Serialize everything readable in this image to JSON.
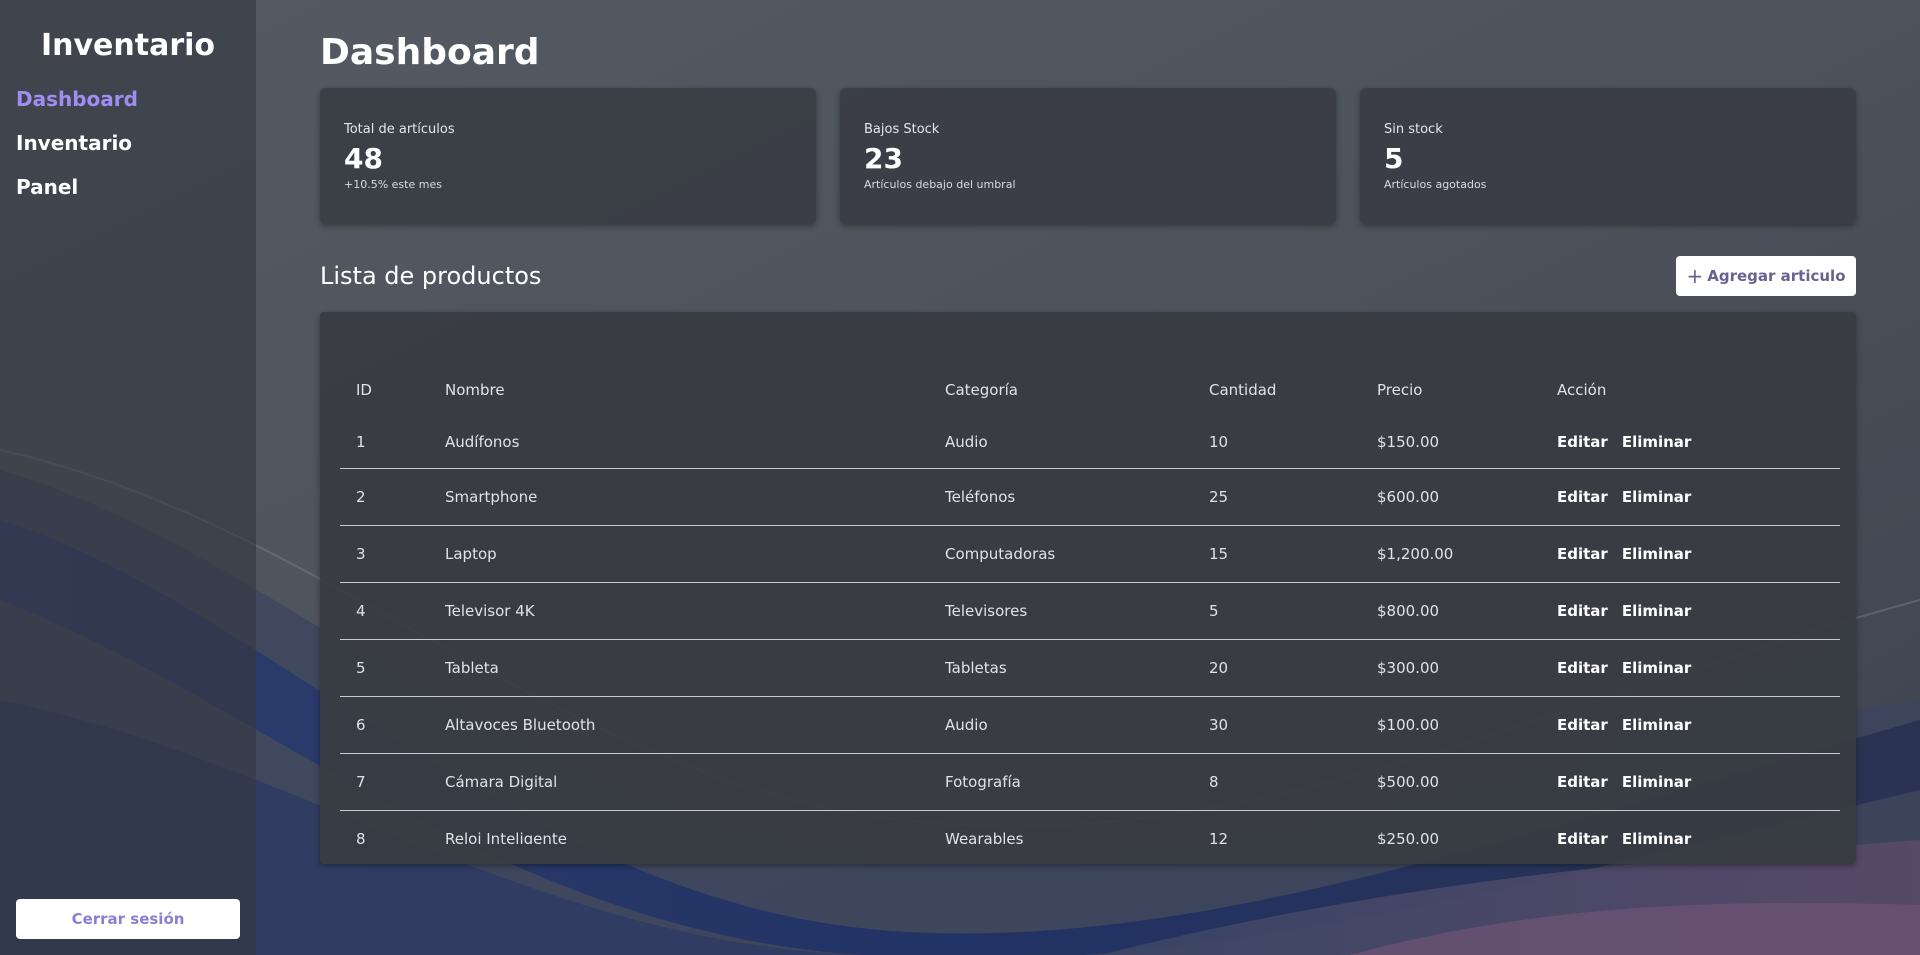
{
  "sidebar": {
    "brand": "Inventario",
    "nav": [
      {
        "label": "Dashboard",
        "active": true
      },
      {
        "label": "Inventario",
        "active": false
      },
      {
        "label": "Panel",
        "active": false
      }
    ],
    "logout_label": "Cerrar sesión"
  },
  "main": {
    "title": "Dashboard",
    "cards": [
      {
        "title": "Total de artículos",
        "value": "48",
        "sub": "+10.5% este mes"
      },
      {
        "title": "Bajos Stock",
        "value": "23",
        "sub": "Artículos debajo del umbral"
      },
      {
        "title": "Sin stock",
        "value": "5",
        "sub": "Artículos agotados"
      }
    ],
    "products_title": "Lista de productos",
    "add_button_label": "Agregar articulo",
    "add_button_icon": "plus-icon",
    "table": {
      "headers": [
        "ID",
        "Nombre",
        "Categoría",
        "Cantidad",
        "Precio",
        "Acción"
      ],
      "edit_label": "Editar",
      "delete_label": "Eliminar",
      "rows": [
        {
          "id": "1",
          "name": "Audífonos",
          "category": "Audio",
          "qty": "10",
          "price": "$150.00"
        },
        {
          "id": "2",
          "name": "Smartphone",
          "category": "Teléfonos",
          "qty": "25",
          "price": "$600.00"
        },
        {
          "id": "3",
          "name": "Laptop",
          "category": "Computadoras",
          "qty": "15",
          "price": "$1,200.00"
        },
        {
          "id": "4",
          "name": "Televisor 4K",
          "category": "Televisores",
          "qty": "5",
          "price": "$800.00"
        },
        {
          "id": "5",
          "name": "Tableta",
          "category": "Tabletas",
          "qty": "20",
          "price": "$300.00"
        },
        {
          "id": "6",
          "name": "Altavoces Bluetooth",
          "category": "Audio",
          "qty": "30",
          "price": "$100.00"
        },
        {
          "id": "7",
          "name": "Cámara Digital",
          "category": "Fotografía",
          "qty": "8",
          "price": "$500.00"
        },
        {
          "id": "8",
          "name": "Reloj Inteligente",
          "category": "Wearables",
          "qty": "12",
          "price": "$250.00"
        }
      ]
    }
  },
  "colors": {
    "accent": "#a18cf2",
    "logout_text": "#8a7fd4",
    "card_bg": "#3a3d44"
  }
}
